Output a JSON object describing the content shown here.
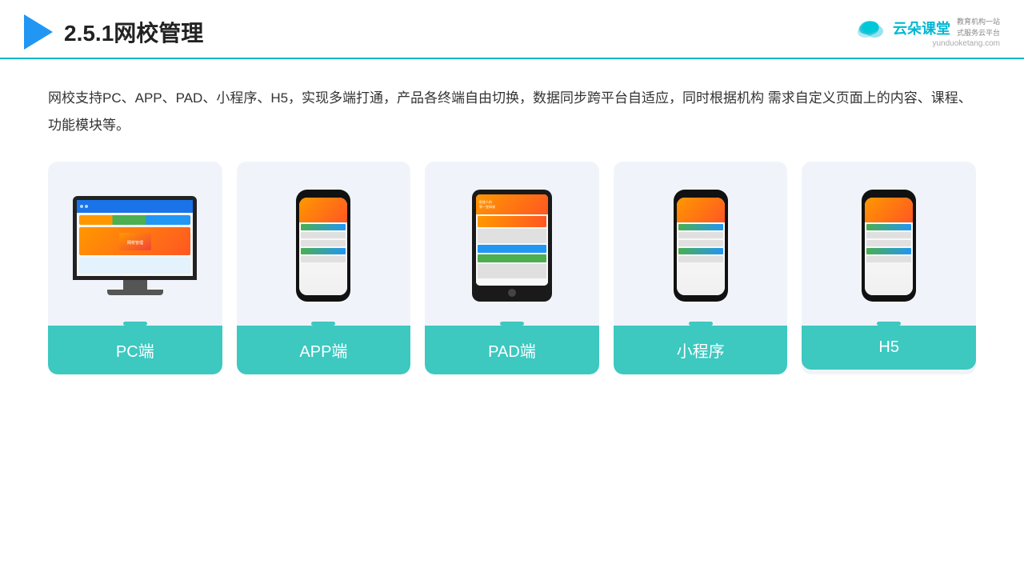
{
  "header": {
    "title": "2.5.1网校管理",
    "logo_name": "云朵课堂",
    "logo_url": "yunduoketang.com",
    "logo_tagline": "教育机构一站\n式服务云平台"
  },
  "description": "网校支持PC、APP、PAD、小程序、H5，实现多端打通，产品各终端自由切换，数据同步跨平台自适应，同时根据机构\n需求自定义页面上的内容、课程、功能模块等。",
  "cards": [
    {
      "id": "pc",
      "label": "PC端"
    },
    {
      "id": "app",
      "label": "APP端"
    },
    {
      "id": "pad",
      "label": "PAD端"
    },
    {
      "id": "mini",
      "label": "小程序"
    },
    {
      "id": "h5",
      "label": "H5"
    }
  ],
  "colors": {
    "accent": "#3dc8c0",
    "title_line": "#00b8c8",
    "logo": "#00b8d4"
  }
}
